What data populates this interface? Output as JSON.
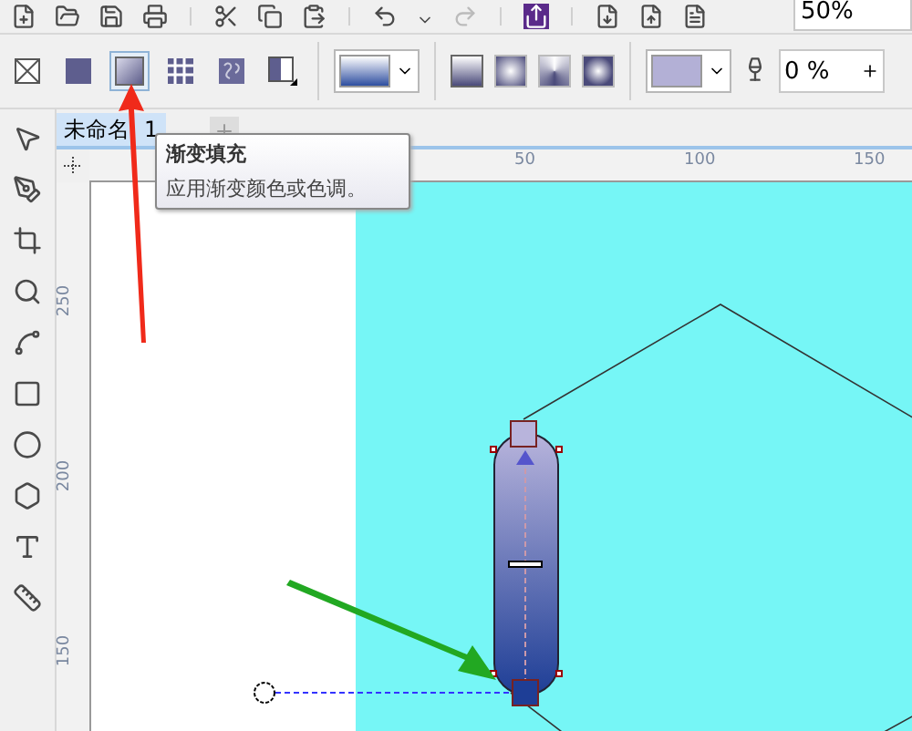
{
  "zoom_field": {
    "value": "50%"
  },
  "fill_types": [
    {
      "kind": "none",
      "selected": false
    },
    {
      "kind": "uniform",
      "selected": false
    },
    {
      "kind": "fountain",
      "selected": true
    },
    {
      "kind": "pattern",
      "selected": false
    },
    {
      "kind": "texture",
      "selected": false
    },
    {
      "kind": "postscript",
      "selected": false
    }
  ],
  "transparency_field": {
    "value": "0 %"
  },
  "document_tab": {
    "label": "未命名",
    "label_tail": "1",
    "selected": true
  },
  "tooltip": {
    "title": "渐变填充",
    "description": "应用渐变颜色或色调。"
  },
  "horizontal_ruler": [
    "50",
    "100",
    "150"
  ],
  "vertical_ruler": [
    "250",
    "200",
    "150"
  ]
}
